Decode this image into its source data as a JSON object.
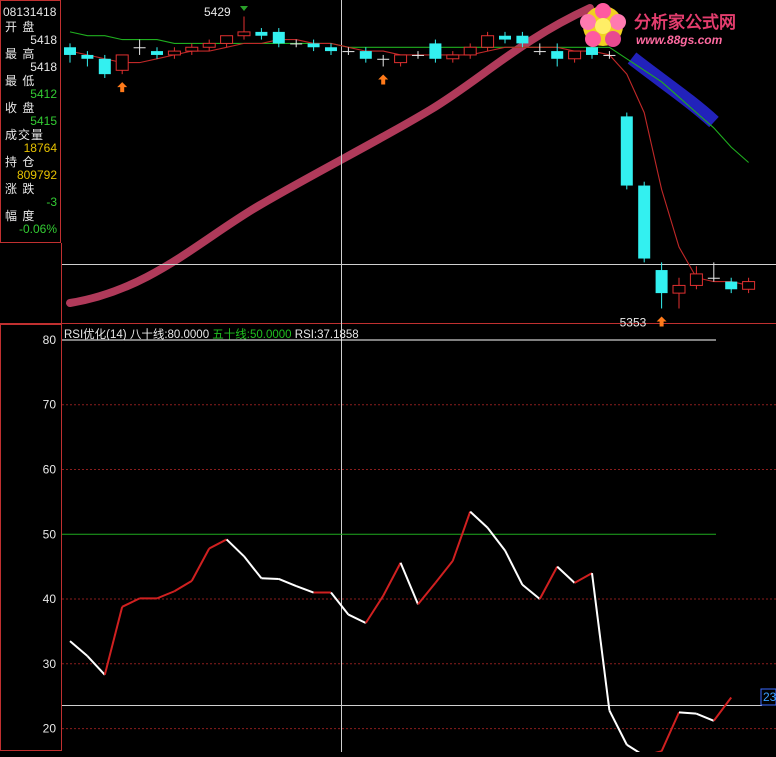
{
  "info_panel": {
    "date": "08131418",
    "rows": [
      {
        "label": "开  盘",
        "value": "5418",
        "color": "#e8e8e8"
      },
      {
        "label": "最  高",
        "value": "5418",
        "color": "#e8e8e8"
      },
      {
        "label": "最  低",
        "value": "5412",
        "color": "#33cc33"
      },
      {
        "label": "收  盘",
        "value": "5415",
        "color": "#33cc33"
      },
      {
        "label": "成交量",
        "value": "18764",
        "color": "#e6c200"
      },
      {
        "label": "持  仓",
        "value": "809792",
        "color": "#e6c200"
      },
      {
        "label": "涨  跌",
        "value": "-3",
        "color": "#33cc33"
      },
      {
        "label": "幅  度",
        "value": "-0.06%",
        "color": "#33cc33"
      }
    ]
  },
  "logo": {
    "title": "分析家公式网",
    "url": "www.88gs.com"
  },
  "colors": {
    "up": "#e03030",
    "down": "#33f0f0",
    "ma_fast": "#c02828",
    "ma_slow": "#1fae1f",
    "ribbon_red": "#b03a5a",
    "ribbon_blue": "#2222bb",
    "rsi_up": "#d02020",
    "rsi_down": "#ffffff",
    "line80": "#ffffff",
    "line50": "#1faa1f",
    "grid": "#8a1d1d",
    "frame": "#c03030"
  },
  "chart_data": [
    {
      "type": "candlestick",
      "candles": [
        {
          "o": 5421,
          "h": 5422,
          "l": 5417,
          "c": 5419
        },
        {
          "o": 5419,
          "h": 5420,
          "l": 5416,
          "c": 5418
        },
        {
          "o": 5418,
          "h": 5419,
          "l": 5413,
          "c": 5414
        },
        {
          "o": 5415,
          "h": 5419,
          "l": 5414,
          "c": 5419
        },
        {
          "o": 5421,
          "h": 5423,
          "l": 5419,
          "c": 5421
        },
        {
          "o": 5420,
          "h": 5421,
          "l": 5418,
          "c": 5419
        },
        {
          "o": 5419,
          "h": 5421,
          "l": 5418,
          "c": 5420
        },
        {
          "o": 5420,
          "h": 5422,
          "l": 5419,
          "c": 5421
        },
        {
          "o": 5421,
          "h": 5423,
          "l": 5420,
          "c": 5422
        },
        {
          "o": 5422,
          "h": 5424,
          "l": 5421,
          "c": 5424
        },
        {
          "o": 5424,
          "h": 5429,
          "l": 5423,
          "c": 5425
        },
        {
          "o": 5425,
          "h": 5426,
          "l": 5423,
          "c": 5424
        },
        {
          "o": 5425,
          "h": 5426,
          "l": 5421,
          "c": 5422
        },
        {
          "o": 5422,
          "h": 5423,
          "l": 5421,
          "c": 5422
        },
        {
          "o": 5422,
          "h": 5423,
          "l": 5420,
          "c": 5421
        },
        {
          "o": 5421,
          "h": 5422,
          "l": 5419,
          "c": 5420
        },
        {
          "o": 5420,
          "h": 5421,
          "l": 5419,
          "c": 5420
        },
        {
          "o": 5420,
          "h": 5421,
          "l": 5417,
          "c": 5418
        },
        {
          "o": 5418,
          "h": 5419,
          "l": 5416,
          "c": 5418
        },
        {
          "o": 5417,
          "h": 5419,
          "l": 5416,
          "c": 5419
        },
        {
          "o": 5419,
          "h": 5420,
          "l": 5418,
          "c": 5419
        },
        {
          "o": 5422,
          "h": 5423,
          "l": 5417,
          "c": 5418
        },
        {
          "o": 5418,
          "h": 5420,
          "l": 5417,
          "c": 5419
        },
        {
          "o": 5419,
          "h": 5422,
          "l": 5418,
          "c": 5421
        },
        {
          "o": 5421,
          "h": 5425,
          "l": 5420,
          "c": 5424
        },
        {
          "o": 5424,
          "h": 5425,
          "l": 5422,
          "c": 5423
        },
        {
          "o": 5424,
          "h": 5425,
          "l": 5421,
          "c": 5422
        },
        {
          "o": 5420,
          "h": 5422,
          "l": 5419,
          "c": 5420
        },
        {
          "o": 5420,
          "h": 5422,
          "l": 5416,
          "c": 5418
        },
        {
          "o": 5418,
          "h": 5420,
          "l": 5417,
          "c": 5420
        },
        {
          "o": 5421,
          "h": 5422,
          "l": 5418,
          "c": 5419
        },
        {
          "o": 5419,
          "h": 5420,
          "l": 5418,
          "c": 5419
        },
        {
          "o": 5403,
          "h": 5404,
          "l": 5384,
          "c": 5385
        },
        {
          "o": 5385,
          "h": 5386,
          "l": 5365,
          "c": 5366
        },
        {
          "o": 5363,
          "h": 5365,
          "l": 5353,
          "c": 5357
        },
        {
          "o": 5357,
          "h": 5361,
          "l": 5353,
          "c": 5359
        },
        {
          "o": 5359,
          "h": 5364,
          "l": 5358,
          "c": 5362
        },
        {
          "o": 5361,
          "h": 5365,
          "l": 5360,
          "c": 5361
        },
        {
          "o": 5360,
          "h": 5361,
          "l": 5357,
          "c": 5358
        },
        {
          "o": 5358,
          "h": 5361,
          "l": 5357,
          "c": 5360
        }
      ],
      "ma_fast": [
        5420,
        5419,
        5418,
        5417,
        5417,
        5418,
        5419,
        5420,
        5420,
        5421,
        5422,
        5422,
        5423,
        5423,
        5422,
        5422,
        5421,
        5420,
        5420,
        5419,
        5419,
        5419,
        5419,
        5419,
        5420,
        5421,
        5421,
        5421,
        5421,
        5420,
        5420,
        5419,
        5414,
        5404,
        5384,
        5369,
        5361,
        5360,
        5360,
        5359
      ],
      "ma_slow": [
        5425,
        5424,
        5424,
        5423,
        5423,
        5423,
        5422,
        5422,
        5422,
        5422,
        5422,
        5422,
        5422,
        5422,
        5422,
        5422,
        5421,
        5421,
        5421,
        5421,
        5421,
        5421,
        5421,
        5421,
        5421,
        5421,
        5421,
        5421,
        5421,
        5421,
        5421,
        5421,
        5418,
        5415,
        5412,
        5408,
        5404,
        5400,
        5395,
        5391
      ],
      "buy_markers": [
        3,
        18,
        34
      ],
      "annotations": [
        {
          "index": 10,
          "text": "5429"
        },
        {
          "index": 34,
          "text": "5353"
        }
      ]
    },
    {
      "type": "line",
      "title": "RSI优化(14)",
      "params": [
        {
          "text": "八十线:80.0000",
          "color": "#e8e8e8"
        },
        {
          "text": "五十线:50.0000",
          "color": "#1fc01f"
        },
        {
          "text": "RSI:37.1858",
          "color": "#e8e8e8"
        }
      ],
      "y_ticks": [
        "80",
        "70",
        "60",
        "50",
        "40",
        "30",
        "20"
      ],
      "ylim": [
        17,
        82
      ],
      "reference_lines": [
        80,
        50
      ],
      "current_label": "23",
      "rsi": [
        33.5,
        31.2,
        28.3,
        38.8,
        40.1,
        40.1,
        41.2,
        42.8,
        47.8,
        49.2,
        46.6,
        43.2,
        43.1,
        42.0,
        41.0,
        41.0,
        37.6,
        36.3,
        40.5,
        45.6,
        39.2,
        42.5,
        45.9,
        53.5,
        51.0,
        47.5,
        42.2,
        40.0,
        45.0,
        42.5,
        44.0,
        22.8,
        17.5,
        15.8,
        16.5,
        22.5,
        22.3,
        21.2,
        24.8
      ]
    }
  ]
}
